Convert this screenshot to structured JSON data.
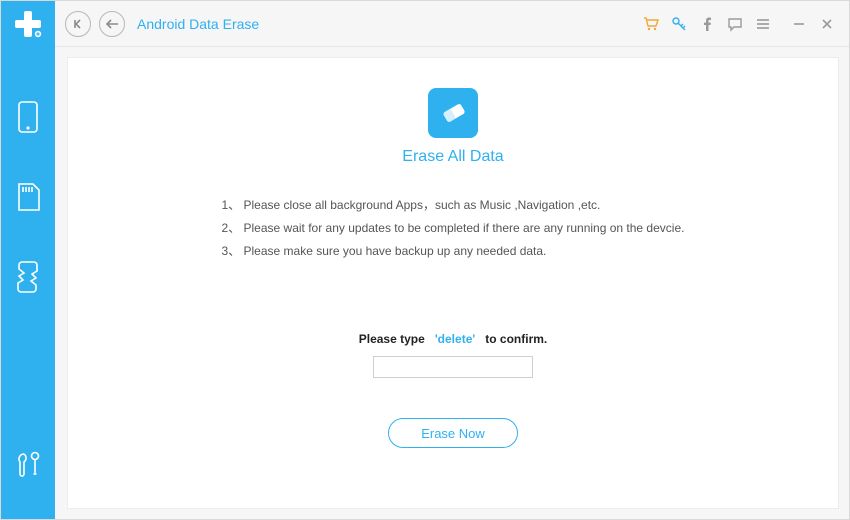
{
  "header": {
    "title": "Android Data Erase"
  },
  "main": {
    "title": "Erase All Data",
    "instructions": [
      "Please close all background Apps，such as Music ,Navigation ,etc.",
      "Please wait for any updates to be completed if there are any running on the devcie.",
      "Please make sure you have backup up any needed data."
    ],
    "confirm_prefix": "Please type",
    "confirm_keyword": "'delete'",
    "confirm_suffix": "to confirm.",
    "input_value": "",
    "erase_button": "Erase Now"
  },
  "numbers": {
    "n1": "1、",
    "n2": "2、",
    "n3": "3、"
  }
}
